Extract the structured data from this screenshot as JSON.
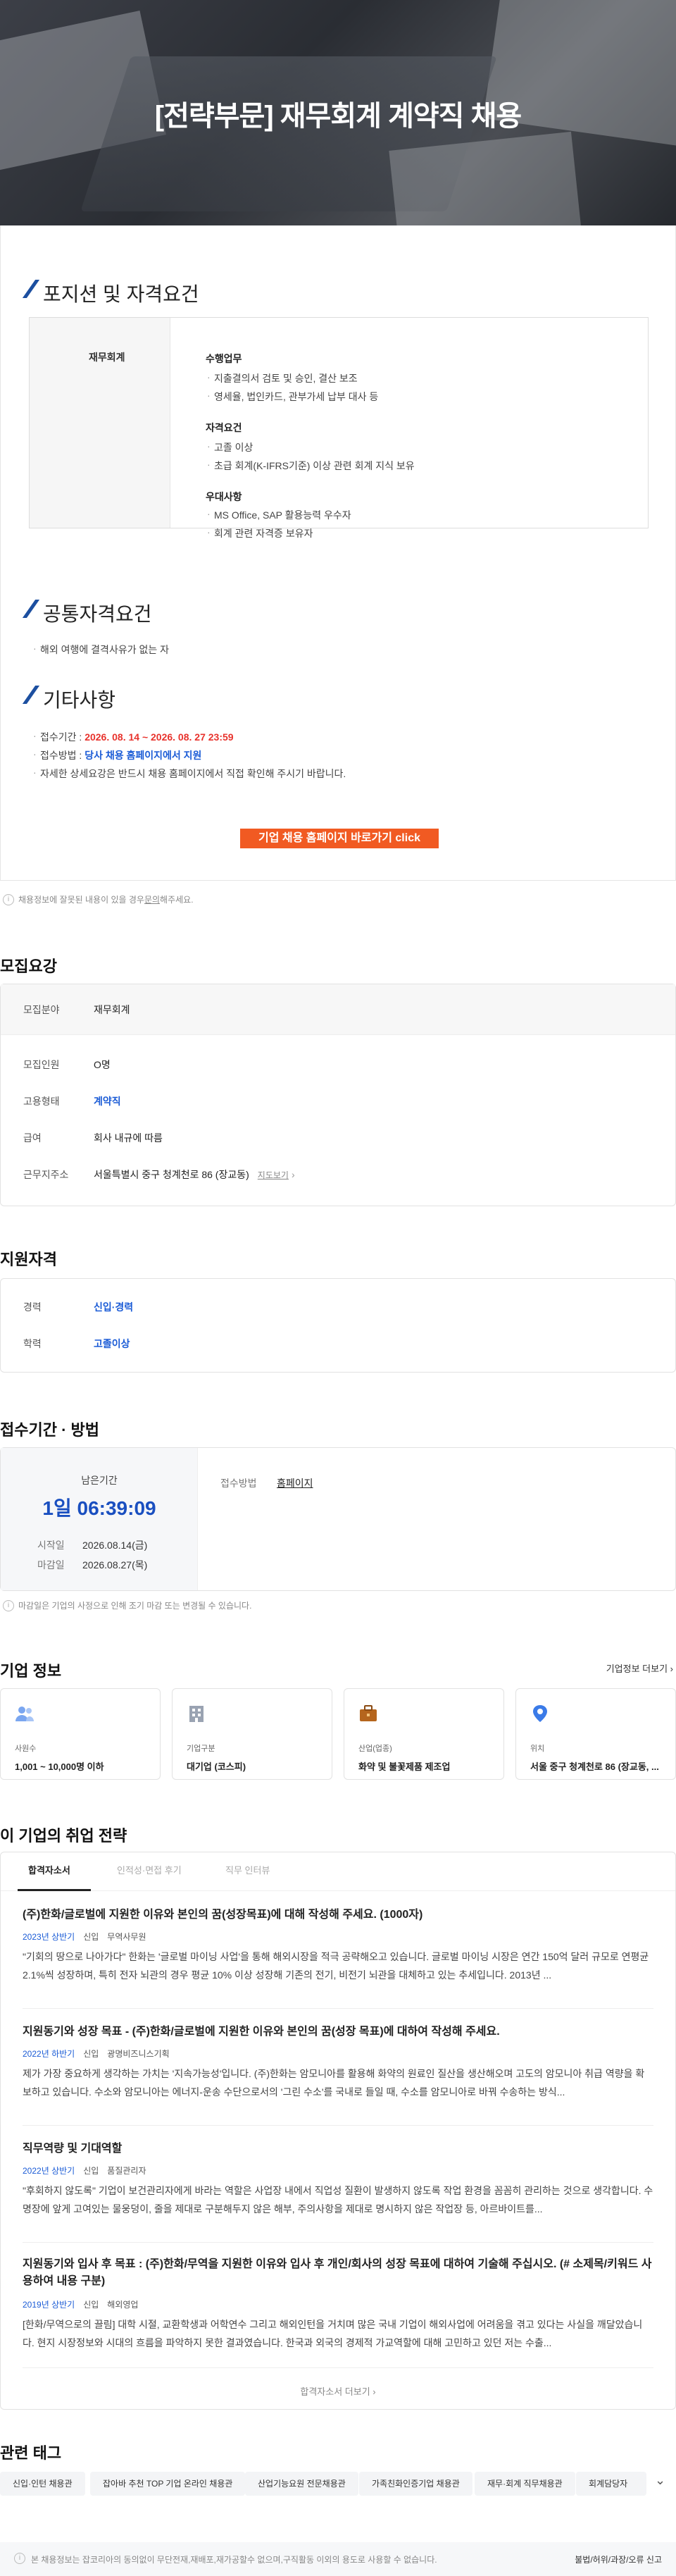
{
  "hero": {
    "title": "[전략부문] 재무회계 계약직 채용"
  },
  "article": {
    "position_heading": "포지션 및 자격요건",
    "position_label": "재무회계",
    "groups": [
      {
        "title": "수행업무",
        "items": [
          "지출결의서 검토 및 승인, 결산 보조",
          "영세율, 법인카드, 관부가세 납부 대사 등"
        ]
      },
      {
        "title": "자격요건",
        "items": [
          "고졸 이상",
          "초급 회계(K-IFRS기준) 이상 관련 회계 지식 보유"
        ]
      },
      {
        "title": "우대사항",
        "items": [
          "MS Office, SAP 활용능력 우수자",
          "회계 관련 자격증 보유자"
        ]
      }
    ],
    "common_heading": "공통자격요건",
    "common_items": [
      "해외 여행에 결격사유가 없는 자"
    ],
    "etc_heading": "기타사항",
    "period_label": "접수기간 :",
    "period_value": "2026. 08. 14 ~ 2026. 08. 27 23:59",
    "method_label": "접수방법 :",
    "method_value": "당사 채용 홈페이지에서 지원",
    "detail_note": "자세한 상세요강은 반드시 채용 홈페이지에서 직접 확인해 주시기 바랍니다.",
    "cta": "기업 채용 홈페이지 바로가기 click"
  },
  "notice1": {
    "prefix": "채용정보에 잘못된 내용이 있을 경우 ",
    "link": "문의",
    "suffix": "해주세요."
  },
  "recruit": {
    "heading": "모집요강",
    "field_label": "모집분야",
    "field_value": "재무회계",
    "rows": [
      {
        "label": "모집인원",
        "value": "O명"
      },
      {
        "label": "고용형태",
        "value": "계약직"
      },
      {
        "label": "급여",
        "value": "회사 내규에 따름"
      },
      {
        "label": "근무지주소",
        "value": "서울특별시 중구 청계천로 86 (장교동)"
      }
    ],
    "map_link": "지도보기"
  },
  "qualify": {
    "heading": "지원자격",
    "rows": [
      {
        "label": "경력",
        "value": "신입·경력"
      },
      {
        "label": "학력",
        "value": "고졸이상"
      }
    ]
  },
  "deadline": {
    "heading": "접수기간 · 방법",
    "remain_label": "남은기간",
    "remain_value": "1일 06:39:09",
    "start_label": "시작일",
    "start_value": "2026.08.14(금)",
    "end_label": "마감일",
    "end_value": "2026.08.27(목)",
    "method_label": "접수방법",
    "method_value": "홈페이지",
    "note": "마감일은 기업의 사정으로 인해 조기 마감 또는 변경될 수 있습니다."
  },
  "company": {
    "heading": "기업 정보",
    "more": "기업정보 더보기",
    "cards": [
      {
        "label": "사원수",
        "value": "1,001 ~ 10,000명 이하",
        "icon": "people-icon"
      },
      {
        "label": "기업구분",
        "value": "대기업 (코스피)",
        "icon": "building-icon"
      },
      {
        "label": "산업(업종)",
        "value": "화약 및 불꽃제품 제조업",
        "icon": "briefcase-icon"
      },
      {
        "label": "위치",
        "value": "서울 중구 청계천로 86 (장교동, ...",
        "icon": "location-pin-icon"
      }
    ]
  },
  "strategy": {
    "heading": "이 기업의 취업 전략",
    "tabs": [
      "합격자소서",
      "인적성·면접 후기",
      "직무 인터뷰"
    ],
    "questions": [
      {
        "title": "(주)한화/글로벌에 지원한 이유와 본인의 꿈(성장목표)에 대해 작성해 주세요. (1000자)",
        "year": "2023년 상반기",
        "type": "신입",
        "job": "무역사무원",
        "text": "\"기회의 땅으로 나아가다\" 한화는 '글로벌 마이닝 사업'을 통해 해외시장을 적극 공략해오고 있습니다. 글로벌 마이닝 시장은 연간 150억 달러 규모로 연평균 2.1%씩 성장하며, 특히 전자 뇌관의 경우 평균 10% 이상 성장해 기존의 전기, 비전기 뇌관을 대체하고 있는 추세입니다. 2013년 ..."
      },
      {
        "title": "지원동기와 성장 목표 - (주)한화/글로벌에 지원한 이유와 본인의 꿈(성장 목표)에 대하여 작성해 주세요.",
        "year": "2022년 하반기",
        "type": "신입",
        "job": "광명비즈니스기획",
        "text": "제가 가장 중요하게 생각하는 가치는 '지속가능성'입니다. (주)한화는 암모니아를 활용해 화약의 원료인 질산을 생산해오며 고도의 암모니아 취급 역량을 확보하고 있습니다. 수소와 암모니아는 에너지-운송 수단으로서의 '그린 수소'를 국내로 들일 때, 수소를 암모니아로 바꿔 수송하는 방식..."
      },
      {
        "title": "직무역량 및 기대역할",
        "year": "2022년 상반기",
        "type": "신입",
        "job": "품질관리자",
        "text": "\"후회하지 않도록\" 기업이 보건관리자에게 바라는 역할은 사업장 내에서 직업성 질환이 발생하지 않도록 작업 환경을 꼼꼼히 관리하는 것으로 생각합니다. 수명장에 앞게 고여있는 물웅덩이, 줄을 제대로 구분해두지 않은 해부, 주의사항을 제대로 명시하지 않은 작업장 등, 아르바이트를..."
      },
      {
        "title": "지원동기와 입사 후 목표 : (주)한화/무역을 지원한 이유와 입사 후 개인/회사의 성장 목표에 대하여 기술해 주십시오. (# 소제목/키워드 사용하여 내용 구분)",
        "year": "2019년 상반기",
        "type": "신입",
        "job": "해외영업",
        "text": "[한화/무역으로의 끌림] 대학 시절, 교환학생과 어학연수 그리고 해외인턴을 거치며 많은 국내 기업이 해외사업에 어려움을 겪고 있다는 사실을 깨달았습니다. 현지 시장정보와 시대의 흐름을 파악하지 못한 결과였습니다. 한국과 외국의 경제적 가교역할에 대해 고민하고 있던 저는 수출..."
      }
    ],
    "more": "합격자소서 더보기"
  },
  "tags": {
    "heading": "관련 태그",
    "items": [
      "신입·인턴 채용관",
      "잡아바 추천 TOP 기업 온라인 채용관",
      "산업기능요원 전문채용관",
      "가족친화인증기업 채용관",
      "재무·회계 직무채용관",
      "회계담당자"
    ]
  },
  "footer": {
    "text": "본 채용정보는 잡코리아의 동의없이 무단전재,재배포,재가공할수 없으며,구직활동 이외의 용도로 사용할 수 없습니다.",
    "report": "불법/허위/과장/오류 신고"
  },
  "colors": {
    "accent": "#1a5bd6",
    "brand_red": "#e8322c",
    "cta": "#f15a22",
    "heading_slash": "#1c4fa0"
  }
}
